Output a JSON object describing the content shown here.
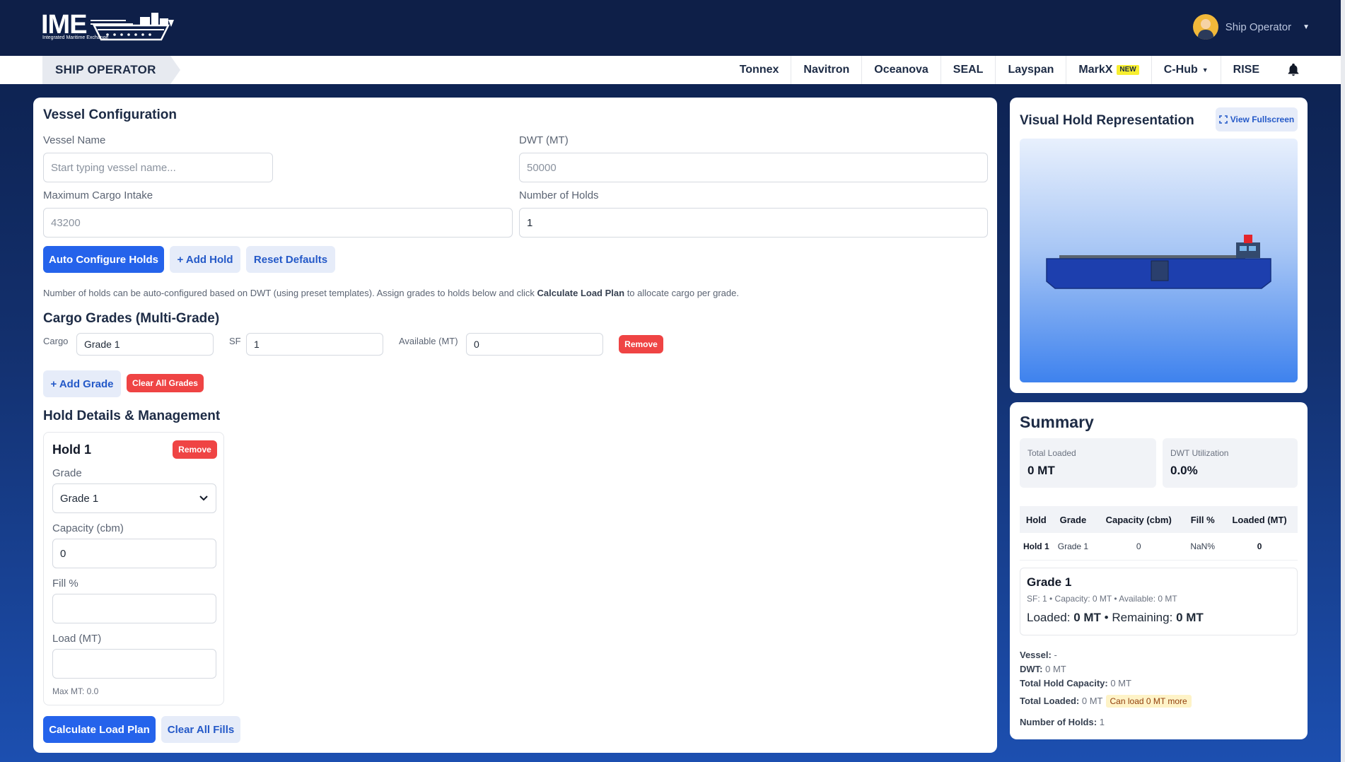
{
  "header": {
    "logo_text": "IME",
    "logo_tagline": "Integrated Maritime Exchange",
    "user_role": "Ship Operator"
  },
  "nav": {
    "section": "SHIP OPERATOR",
    "links": [
      "Tonnex",
      "Navitron",
      "Oceanova",
      "SEAL",
      "Layspan",
      "MarkX",
      "C-Hub",
      "RISE"
    ],
    "markx_badge": "NEW"
  },
  "vessel_config": {
    "title": "Vessel Configuration",
    "vessel_name_label": "Vessel Name",
    "vessel_name_placeholder": "Start typing vessel name...",
    "dwt_label": "DWT (MT)",
    "dwt_value": "50000",
    "max_cargo_label": "Maximum Cargo Intake",
    "max_cargo_value": "43200",
    "num_holds_label": "Number of Holds",
    "num_holds_value": "1",
    "auto_configure": "Auto Configure Holds",
    "add_hold": "+ Add Hold",
    "reset_defaults": "Reset Defaults",
    "help_prefix": "Number of holds can be auto-configured based on DWT (using preset templates). Assign grades to holds below and click ",
    "help_bold": "Calculate Load Plan",
    "help_suffix": " to allocate cargo per grade."
  },
  "cargo_grades": {
    "title": "Cargo Grades (Multi-Grade)",
    "cargo_label": "Cargo",
    "cargo_value": "Grade 1",
    "sf_label": "SF",
    "sf_value": "1",
    "available_label": "Available (MT)",
    "available_value": "0",
    "remove": "Remove",
    "add_grade": "+ Add Grade",
    "clear_all": "Clear All Grades"
  },
  "holds": {
    "title": "Hold Details & Management",
    "hold_name": "Hold 1",
    "remove": "Remove",
    "grade_label": "Grade",
    "grade_value": "Grade 1",
    "capacity_label": "Capacity (cbm)",
    "capacity_value": "0",
    "fill_label": "Fill %",
    "fill_value": "",
    "load_label": "Load (MT)",
    "load_value": "",
    "max_mt": "Max MT: 0.0",
    "calculate": "Calculate Load Plan",
    "clear_fills": "Clear All Fills"
  },
  "visual": {
    "title": "Visual Hold Representation",
    "fullscreen": "View Fullscreen"
  },
  "summary": {
    "title": "Summary",
    "total_loaded_label": "Total Loaded",
    "total_loaded_value": "0 MT",
    "dwt_util_label": "DWT Utilization",
    "dwt_util_value": "0.0%",
    "table_headers": [
      "Hold",
      "Grade",
      "Capacity (cbm)",
      "Fill %",
      "Loaded (MT)"
    ],
    "table_row": [
      "Hold 1",
      "Grade 1",
      "0",
      "NaN%",
      "0"
    ],
    "grade_title": "Grade 1",
    "grade_meta": "SF: 1 • Capacity: 0 MT • Available: 0 MT",
    "loaded_label": "Loaded:",
    "loaded_value": "0 MT",
    "remaining_label": "• Remaining:",
    "remaining_value": "0 MT",
    "vessel_label": "Vessel:",
    "vessel_value": "-",
    "dwt_label": "DWT:",
    "dwt_value": "0 MT",
    "thc_label": "Total Hold Capacity:",
    "thc_value": "0 MT",
    "tl_label": "Total Loaded:",
    "tl_value": "0 MT",
    "can_load": "Can load 0 MT more",
    "noh_label": "Number of Holds:",
    "noh_value": "1"
  }
}
